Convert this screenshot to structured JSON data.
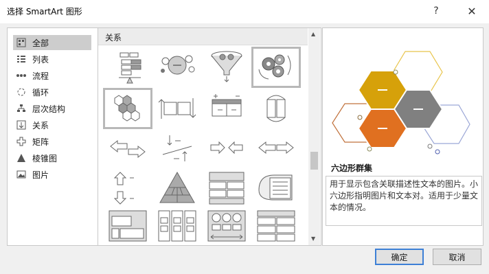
{
  "window": {
    "title": "选择 SmartArt 图形",
    "help_label": "?",
    "close_label": "✕"
  },
  "categories": [
    {
      "label": "全部",
      "icon": "all-icon",
      "selected": true
    },
    {
      "label": "列表",
      "icon": "list-icon"
    },
    {
      "label": "流程",
      "icon": "process-icon"
    },
    {
      "label": "循环",
      "icon": "cycle-icon"
    },
    {
      "label": "层次结构",
      "icon": "hierarchy-icon"
    },
    {
      "label": "关系",
      "icon": "relationship-icon"
    },
    {
      "label": "矩阵",
      "icon": "matrix-icon"
    },
    {
      "label": "棱锥图",
      "icon": "pyramid-icon"
    },
    {
      "label": "图片",
      "icon": "picture-icon"
    }
  ],
  "gallery": {
    "section_label": "关系",
    "tiles": [
      "balance",
      "counterbalance-circles",
      "funnel",
      "gears",
      "hexagon-cluster",
      "opposing-arrows",
      "plus-minus",
      "reverse-arrows",
      "converging-arrows",
      "diverging-arrows",
      "opposing-ideas",
      "arrows-pair",
      "up-down-arrows",
      "segmented-pyramid",
      "stacked-bars",
      "nested-target",
      "picture-grid",
      "three-column",
      "circle-columns",
      "table-list"
    ],
    "selected_index": 4
  },
  "preview": {
    "name": "六边形群集",
    "description": "用于显示包含关联描述性文本的图片。小六边形指明图片和文本对。适用于少量文本的情况。",
    "colors": {
      "gold": "#d6a10a",
      "orange": "#e07020",
      "gray": "#808080",
      "outline_orange": "#c0703a",
      "outline_gold": "#e8c44a",
      "outline_blue": "#9aa6d6"
    }
  },
  "buttons": {
    "ok_label": "确定",
    "cancel_label": "取消"
  }
}
